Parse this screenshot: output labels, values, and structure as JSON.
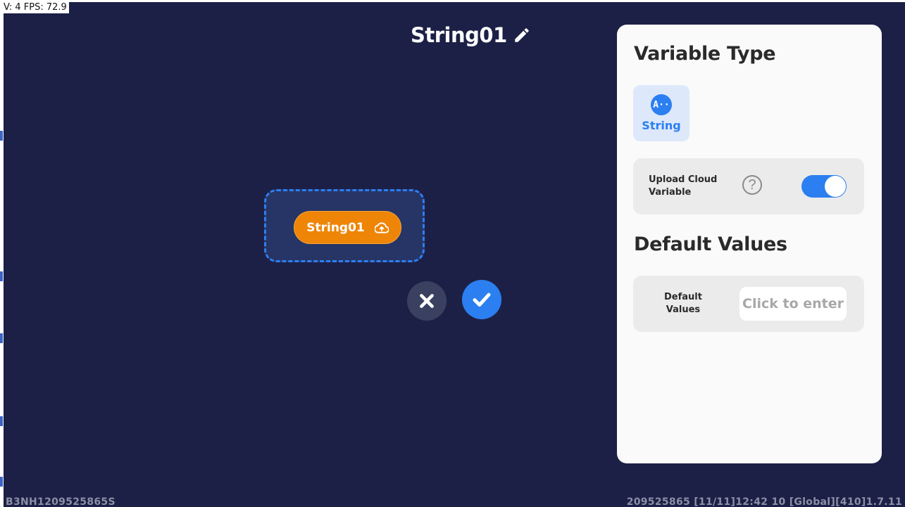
{
  "debug": {
    "fps_text": "V: 4 FPS: 72.9"
  },
  "header": {
    "title": "String01",
    "edit_icon": "pencil-icon"
  },
  "canvas": {
    "variable_chip": {
      "label": "String01",
      "icon": "cloud-upload-icon"
    }
  },
  "actions": {
    "cancel_icon": "close-icon",
    "confirm_icon": "check-icon"
  },
  "panel": {
    "variable_type_heading": "Variable Type",
    "type_option": {
      "icon_text": "A··",
      "label": "String",
      "selected": true
    },
    "upload_cloud": {
      "label_line1": "Upload Cloud",
      "label_line2": "Variable",
      "help_glyph": "?",
      "enabled": true
    },
    "default_values_heading": "Default Values",
    "default_values_row": {
      "label_line1": "Default",
      "label_line2": "Values",
      "input_placeholder": "Click to enter",
      "input_value": ""
    }
  },
  "footer": {
    "device_id": "B3NH1209525865S",
    "status": "209525865    [11/11]12:42 10  [Global][410]1.7.11"
  },
  "colors": {
    "background": "#1c2046",
    "accent_blue": "#2b7ff0",
    "variable_orange": "#ee8506",
    "panel_bg": "#fafafa"
  }
}
